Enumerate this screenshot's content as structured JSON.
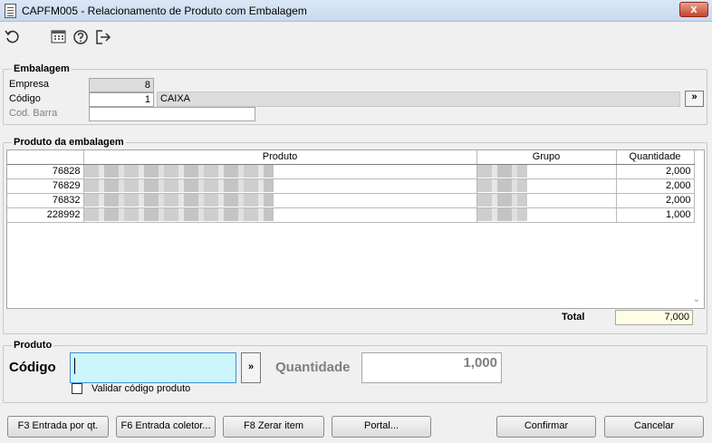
{
  "window": {
    "title": "CAPFM005 - Relacionamento de Produto com Embalagem",
    "close_glyph": "x"
  },
  "toolbar": {
    "icons": [
      "refresh-icon",
      "calculator-icon",
      "help-icon",
      "exit-icon"
    ]
  },
  "embalagem": {
    "legend": "Embalagem",
    "empresa_label": "Empresa",
    "empresa_value": "8",
    "codigo_label": "Código",
    "codigo_value": "1",
    "codigo_desc": "CAIXA",
    "lookup_label": "»",
    "cod_barra_label": "Cod. Barra",
    "cod_barra_value": ""
  },
  "produto_embalagem": {
    "legend": "Produto da embalagem",
    "columns": [
      "",
      "Produto",
      "Grupo",
      "Quantidade"
    ],
    "rows": [
      {
        "code": "76828",
        "produto": "",
        "grupo": "",
        "quantidade": "2,000"
      },
      {
        "code": "76829",
        "produto": "",
        "grupo": "",
        "quantidade": "2,000"
      },
      {
        "code": "76832",
        "produto": "",
        "grupo": "",
        "quantidade": "2,000"
      },
      {
        "code": "228992",
        "produto": "",
        "grupo": "",
        "quantidade": "1,000"
      }
    ],
    "total_label": "Total",
    "total_value": "7,000"
  },
  "produto": {
    "legend": "Produto",
    "codigo_label": "Código",
    "codigo_value": "",
    "lookup_label": "»",
    "quantidade_label": "Quantidade",
    "quantidade_value": "1,000",
    "validar_label": "Validar código produto",
    "validar_checked": false
  },
  "buttons": {
    "f3": "F3 Entrada por qt.",
    "f6": "F6 Entrada coletor...",
    "f8": "F8 Zerar item",
    "portal": "Portal...",
    "confirmar": "Confirmar",
    "cancelar": "Cancelar"
  },
  "colors": {
    "active_input": "#ccf6fb",
    "total_bg": "#fffde6",
    "readonly_bg": "#dcdcdc"
  }
}
